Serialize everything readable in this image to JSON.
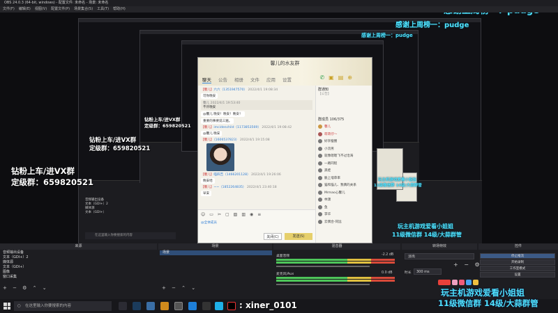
{
  "window": {
    "title": "OBS 24.0.3 (64-bit, windows) - 配置文件: 未命名 - 场景: 未命名"
  },
  "menu": [
    "文件(F)",
    "编辑(E)",
    "视图(V)",
    "配置文件(P)",
    "场景集合(S)",
    "工具(T)",
    "帮助(H)"
  ],
  "overlay": {
    "thanks": "感谢上周榜一：pudge",
    "diamond": "钻粉上车/进VX群",
    "group": "定级群：659820521"
  },
  "qq": {
    "title": "馨儿的水友群",
    "tabs": [
      "聊天",
      "公告",
      "相册",
      "文件",
      "应用",
      "设置"
    ],
    "messages": [
      {
        "tag": "【馨儿】",
        "name": "六六（1351947570）",
        "time": "2022/4/1 19:08:34",
        "text": "可你晚安"
      },
      {
        "tag": "",
        "name": "馨儿",
        "time": "2022/4/1 19:53:40",
        "text": "不许晚安"
      },
      {
        "tag": "",
        "name": "",
        "time": "",
        "text": "@馨儿 晚安！晚安！晚安！"
      },
      {
        "tag": "",
        "name": "",
        "time": "",
        "text": "重要的事要说三遍。"
      },
      {
        "tag": "【馨儿】",
        "name": "imcidenchild（1173853569）",
        "time": "2022/4/1 19:08:42",
        "text": "@馨儿 晚安"
      },
      {
        "tag": "【馨儿】",
        "name": "（1606537823）",
        "time": "2022/4/1 19:15:08",
        "text": ""
      },
      {
        "tag": "【馨儿】",
        "name": "喵四吉（1466201128）",
        "time": "2022/4/1 19:26:06",
        "text": "晚安哈"
      },
      {
        "tag": "【馨儿】",
        "name": "~~（1852264835）",
        "time": "2022/4/1 23:40:18",
        "text": "早安"
      }
    ],
    "input_placeholder": "@全体成员",
    "close_label": "关闭(C)",
    "send_label": "发送(S)",
    "notice_label": "群通知",
    "notice_text": "【公告】",
    "member_header": "群成员 106/375",
    "members": [
      "馨儿",
      "萌萌仔～",
      "好享瘦圈",
      "小流男",
      "就像嗯嗯飞不过沧海",
      "一路同程",
      "黑娃",
      "脆上墙草率",
      "猫和猫儿、我俩的关系",
      "Mrmao心馨儿",
      "林潇",
      "鱼",
      "李华",
      "云偶合-同远"
    ]
  },
  "dock": {
    "headers": [
      "来源",
      "场景",
      "混音器",
      "转场特效",
      "控件"
    ],
    "sources": [
      "音频输出设备",
      "文本（GDI+）2",
      "媒体源",
      "文本（GDI+）",
      "图像",
      "窗口采集"
    ],
    "scenes": [
      "场景"
    ],
    "mixer": [
      {
        "name": "桌面音频",
        "db": "-2.2 dB"
      },
      {
        "name": "麦克风/Aux",
        "db": "0.0 dB"
      }
    ],
    "transition": {
      "type": "淡出",
      "duration_label": "时长",
      "duration": "300 ms"
    },
    "controls": [
      "停止推流",
      "开始录制",
      "工作室模式",
      "设置",
      "退出"
    ]
  },
  "taskbar": {
    "search_placeholder": "在这里输入你要搜索的内容",
    "username": ": xiner_0101"
  },
  "badge": {
    "line1": "玩主机游戏爱看小姐姐",
    "line2": "11级微信群 14级/大蒜群管"
  }
}
